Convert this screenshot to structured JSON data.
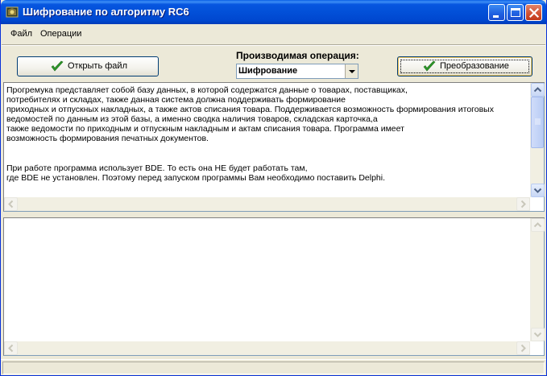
{
  "window": {
    "title": "Шифрование по алгоритму RC6"
  },
  "menu": {
    "items": [
      {
        "label": "Файл"
      },
      {
        "label": "Операции"
      }
    ]
  },
  "toolbar": {
    "open_file_label": "Открыть файл",
    "operation_label": "Производимая операция:",
    "operation_value": "Шифрование",
    "convert_label": "Преобразование"
  },
  "input_memo": {
    "text": "Прогремука представляет собой базу данных, в которой содержатся данные о товарах, поставщиках,\nпотребителях и складах, также данная система должна поддерживать формирование\nприходных и отпускных накладных, а также актов списания товара. Поддерживается возможность формирования итоговых\nведомостей по данным из этой базы, а именно сводка наличия товаров, складская карточка,а\nтакже ведомости по приходным и отпускным накладным и актам списания товара. Программа имеет\nвозможность формирования печатных документов.\n\n\nПри работе программа использует BDE. То есть она НЕ будет работать там,\nгде BDE не установлен. Поэтому перед запуском программы Вам необходимо поставить Delphi."
  },
  "output_memo": {
    "text": ""
  },
  "colors": {
    "titlebar": "#0250D8",
    "window_bg": "#ECE9D8",
    "check_green": "#2E9A2A"
  }
}
